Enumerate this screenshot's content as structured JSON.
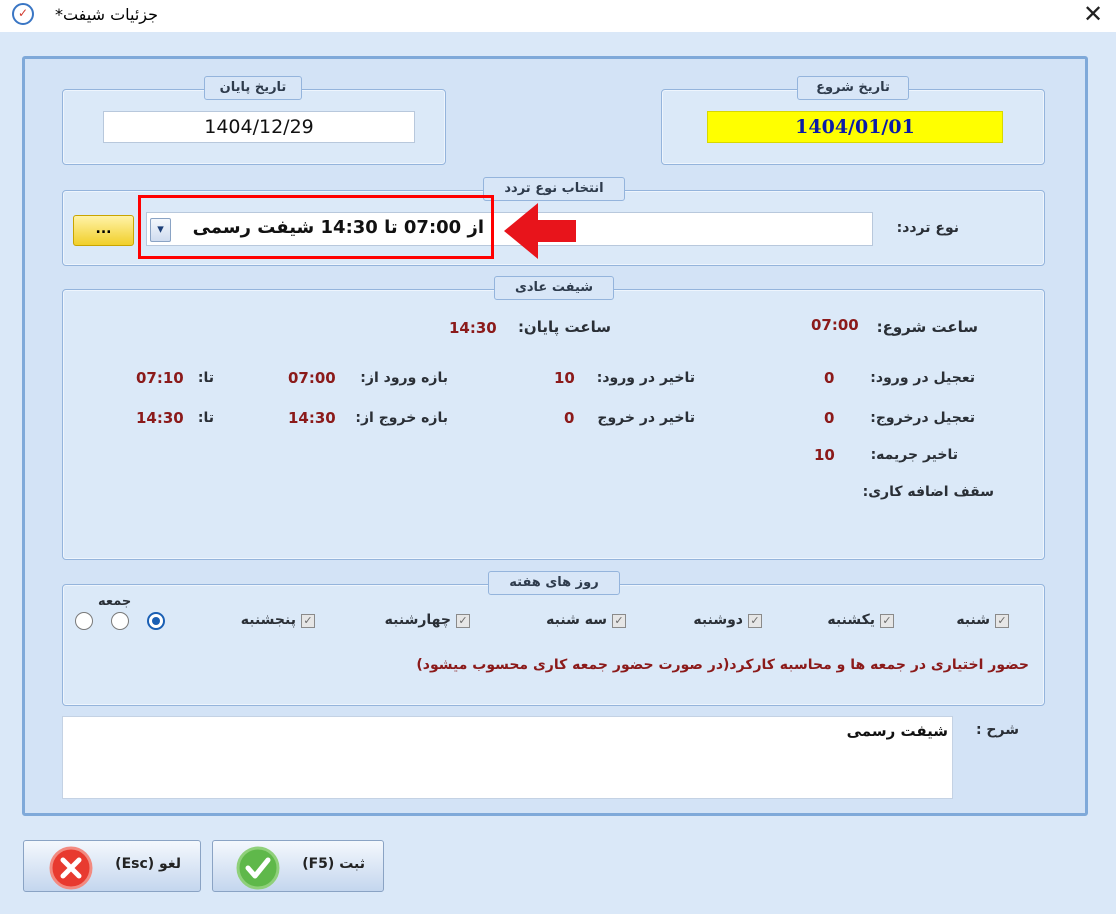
{
  "window": {
    "title": "جزئیات شیفت*"
  },
  "start_date": {
    "legend": "تاریخ شروع",
    "value": "1404/01/01"
  },
  "end_date": {
    "legend": "تاریخ پایان",
    "value": "1404/12/29"
  },
  "attendance_type": {
    "legend": "انتخاب نوع تردد",
    "label": "نوع تردد:",
    "selected": "از 07:00 تا 14:30 شیفت رسمی",
    "browse_label": "...",
    "dropdown_glyph": "▾"
  },
  "shift": {
    "legend": "شیفت عادی",
    "start_time_label": "ساعت شروع:",
    "start_time": "07:00",
    "end_time_label": "ساعت پایان:",
    "end_time": "14:30",
    "early_entry_label": "تعجیل در ورود:",
    "early_entry": "0",
    "late_entry_label": "تاخیر در ورود:",
    "late_entry": "10",
    "entry_range_label": "بازه ورود از:",
    "entry_from": "07:00",
    "entry_to_label": "تا:",
    "entry_to": "07:10",
    "early_exit_label": "تعجیل درخروج:",
    "early_exit": "0",
    "late_exit_label": "تاخیر در خروج",
    "late_exit": "0",
    "exit_range_label": "بازه خروج از:",
    "exit_from": "14:30",
    "exit_to_label": "تا:",
    "exit_to": "14:30",
    "penalty_delay_label": "تاخیر جریمه:",
    "penalty_delay": "10",
    "overtime_cap_label": "سقف اضافه کاری:"
  },
  "weekdays": {
    "legend": "روز های هفته",
    "days": [
      "شنبه",
      "یکشنبه",
      "دوشنبه",
      "سه شنبه",
      "چهارشنبه",
      "پنجشنبه"
    ],
    "friday_label": "جمعه",
    "checkmark": "✓",
    "note": "حضور اختیاری در جمعه ها و محاسبه کارکرد(در صورت حضور جمعه کاری محسوب میشود)"
  },
  "description": {
    "label": "شرح :",
    "value": "شیفت رسمی"
  },
  "buttons": {
    "save": "ثبت  (F5)",
    "cancel": "لغو  (Esc)"
  },
  "colors": {
    "highlight_box": "#ff0000",
    "arrow": "#e8141b",
    "start_date_bg": "#ffff00",
    "start_date_text": "#0a1aa8",
    "value_text": "#8b1a1a"
  }
}
